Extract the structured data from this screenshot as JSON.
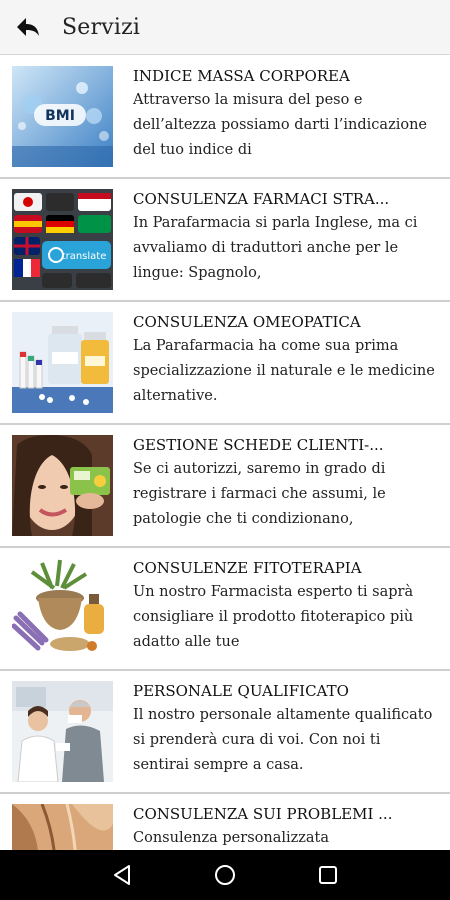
{
  "appbar": {
    "title": "Servizi",
    "back_icon": "arrow-back-icon"
  },
  "services": [
    {
      "title": "INDICE MASSA CORPOREA",
      "description": "Attraverso la misura del peso e dell’altezza possiamo darti l’indicazione del tuo indice di",
      "thumb_text": "BMI"
    },
    {
      "title": "CONSULENZA FARMACI STRA...",
      "description": "In Parafarmacia si parla Inglese, ma ci avvaliamo di traduttori anche per le lingue: Spagnolo,",
      "thumb_text": "translate"
    },
    {
      "title": "CONSULENZA OMEOPATICA",
      "description": "La Parafarmacia ha come sua prima specializzazione il naturale e le medicine alternative.",
      "thumb_text": ""
    },
    {
      "title": "GESTIONE SCHEDE CLIENTI-...",
      "description": "Se ci autorizzi, saremo in grado di registrare i farmaci che assumi, le patologie che ti condizionano,",
      "thumb_text": ""
    },
    {
      "title": "CONSULENZE FITOTERAPIA",
      "description": "Un nostro Farmacista esperto ti saprà consigliare il prodotto fitoterapico più adatto alle tue",
      "thumb_text": ""
    },
    {
      "title": "PERSONALE QUALIFICATO",
      "description": "Il nostro personale altamente qualificato si prenderà cura di voi. Con noi ti sentirai sempre a casa.",
      "thumb_text": ""
    },
    {
      "title": "CONSULENZA SUI PROBLEMI ...",
      "description": "Consulenza personalizzata",
      "thumb_text": ""
    }
  ],
  "navbar": {
    "back": "nav-back-icon",
    "home": "nav-home-icon",
    "recents": "nav-recents-icon"
  },
  "colors": {
    "appbar_bg": "#f5f5f5",
    "divider": "#cfcfcf",
    "navbar_bg": "#000000"
  }
}
